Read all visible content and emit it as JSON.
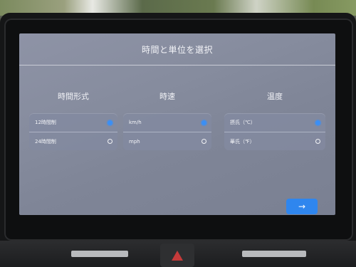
{
  "screen": {
    "title": "時間と単位を選択"
  },
  "columns": [
    {
      "header": "時間形式",
      "options": [
        {
          "label": "12時間制",
          "selected": true
        },
        {
          "label": "24時間制",
          "selected": false
        }
      ]
    },
    {
      "header": "時速",
      "options": [
        {
          "label": "km/h",
          "selected": true
        },
        {
          "label": "mph",
          "selected": false
        }
      ]
    },
    {
      "header": "温度",
      "options": [
        {
          "label": "摂氏（℃）",
          "selected": true
        },
        {
          "label": "華氏（℉）",
          "selected": false
        }
      ]
    }
  ],
  "next_button": {
    "icon": "arrow-right-icon",
    "glyph": "→"
  },
  "colors": {
    "accent": "#2f86ee",
    "selected_radio": "#3b8ff5"
  }
}
